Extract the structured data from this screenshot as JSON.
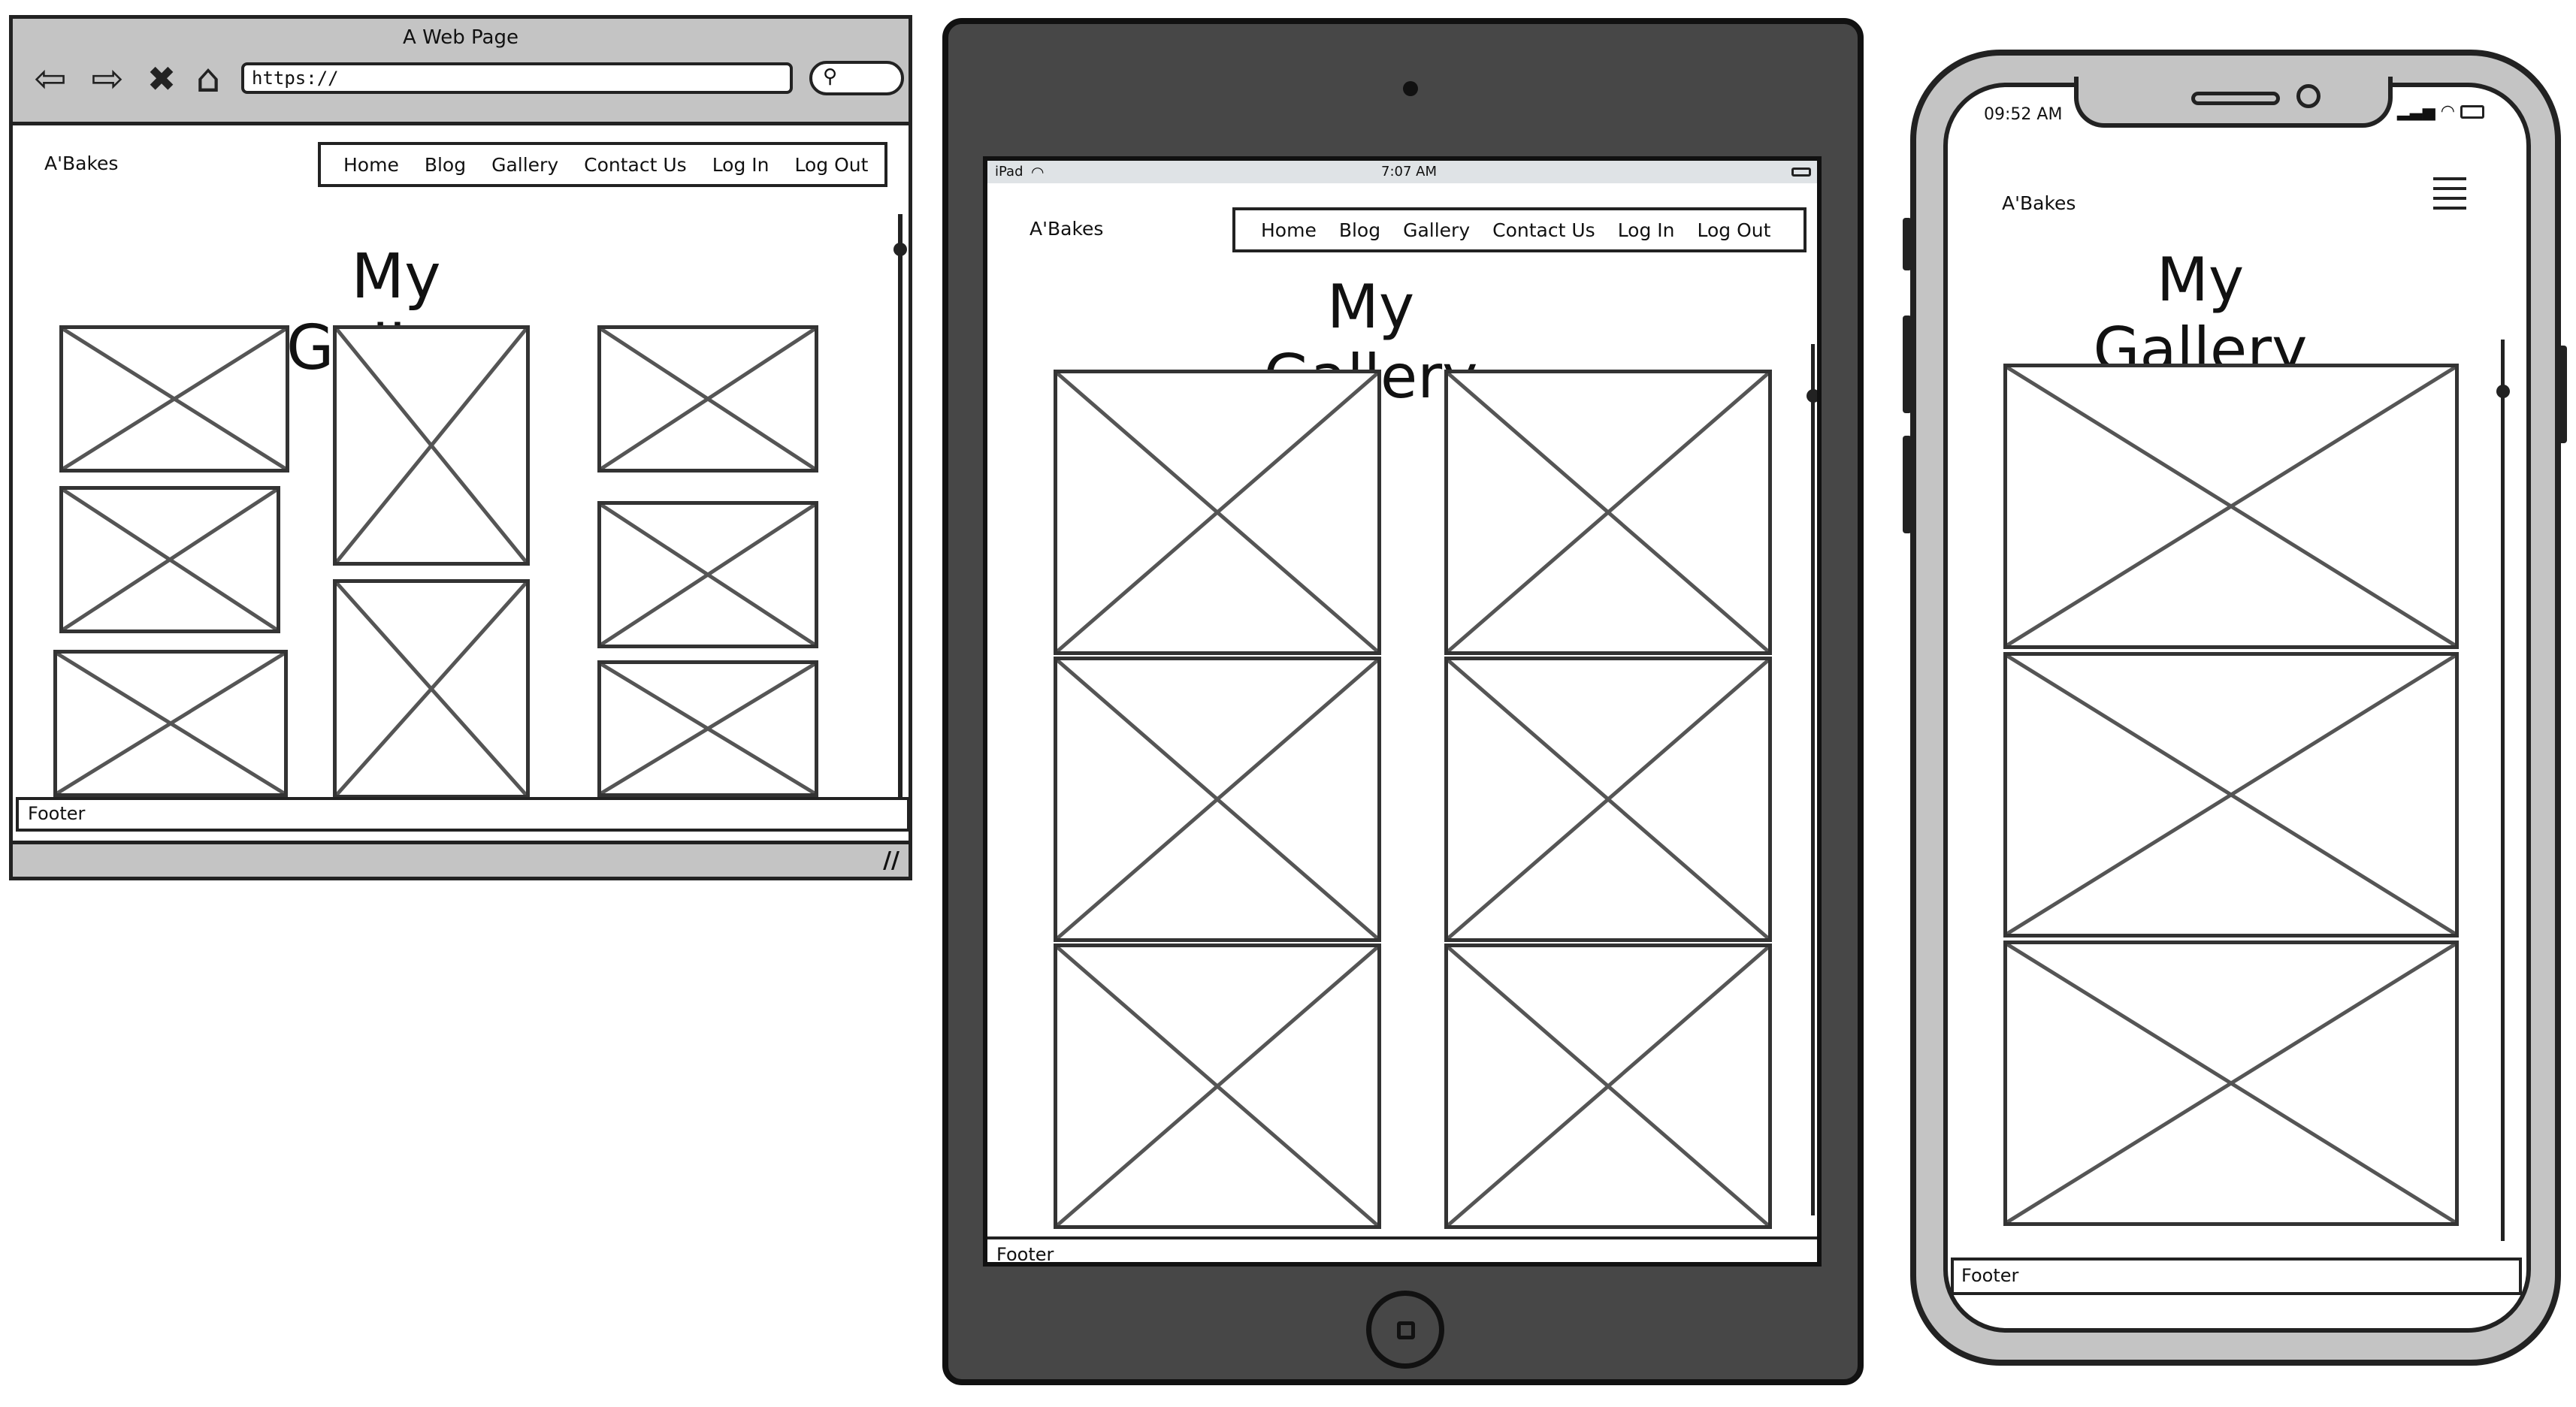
{
  "desktop": {
    "window_title": "A Web Page",
    "url": "https://",
    "brand": "A'Bakes",
    "nav": [
      "Home",
      "Blog",
      "Gallery",
      "Contact Us",
      "Log In",
      "Log Out"
    ],
    "heading": "My Gallery",
    "footer": "Footer"
  },
  "tablet": {
    "status": {
      "device": "iPad",
      "time": "7:07 AM"
    },
    "brand": "A'Bakes",
    "nav": [
      "Home",
      "Blog",
      "Gallery",
      "Contact Us",
      "Log In",
      "Log Out"
    ],
    "heading": "My Gallery",
    "footer": "Footer"
  },
  "phone": {
    "status": {
      "time": "09:52 AM"
    },
    "brand": "A'Bakes",
    "heading": "My Gallery",
    "footer": "Footer"
  },
  "icons": [
    "back-icon",
    "forward-icon",
    "close-icon",
    "home-icon",
    "search-icon",
    "resize-handle-icon",
    "wifi-icon",
    "battery-icon",
    "signal-icon",
    "hamburger-menu-icon",
    "image-placeholder-icon"
  ]
}
